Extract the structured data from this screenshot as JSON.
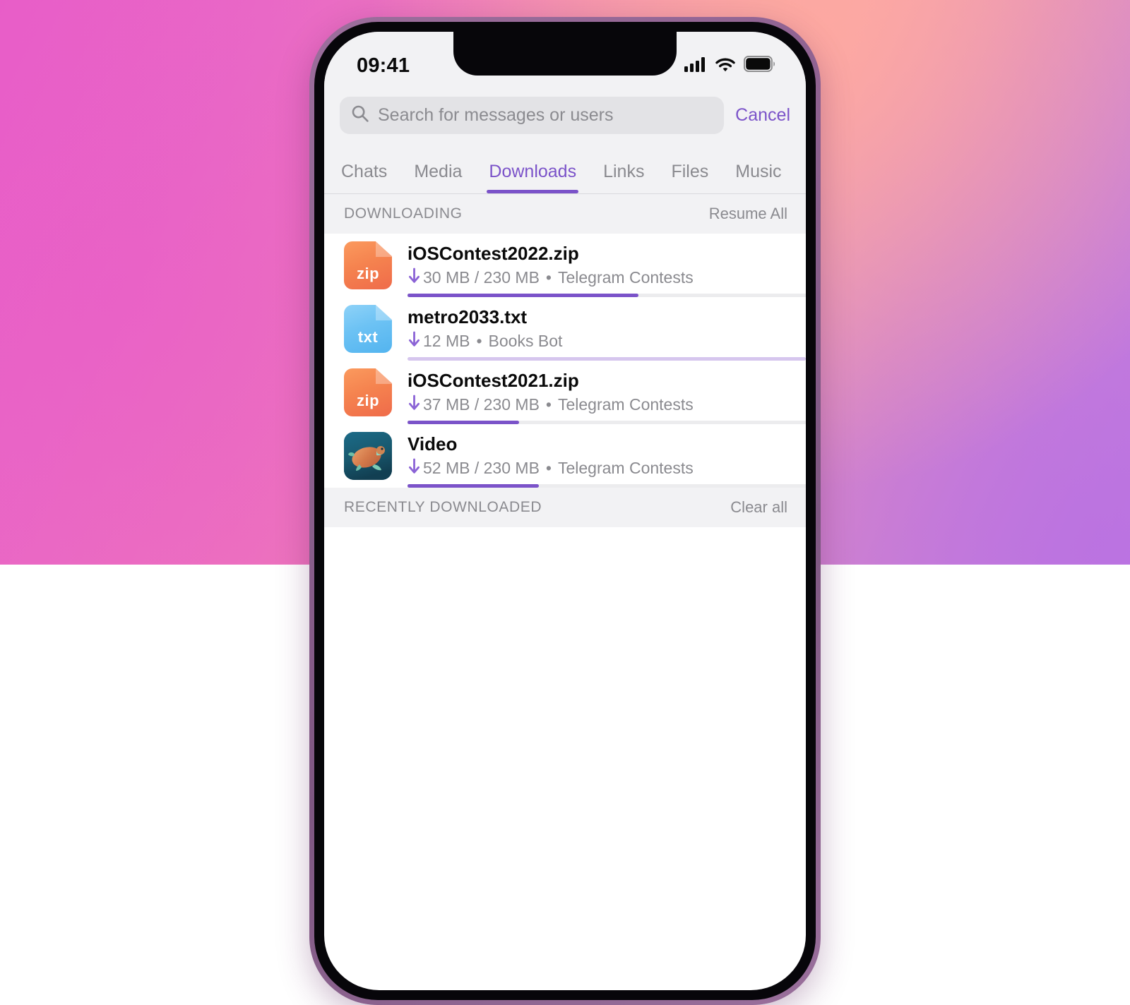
{
  "status_bar": {
    "time": "09:41",
    "signal_icon": "cellular-signal-icon",
    "wifi_icon": "wifi-icon",
    "battery_icon": "battery-full-icon"
  },
  "search": {
    "icon": "search-icon",
    "placeholder": "Search for messages or users",
    "value": "",
    "cancel_label": "Cancel"
  },
  "tabs": [
    {
      "label": "Chats",
      "active": false
    },
    {
      "label": "Media",
      "active": false
    },
    {
      "label": "Downloads",
      "active": true
    },
    {
      "label": "Links",
      "active": false
    },
    {
      "label": "Files",
      "active": false
    },
    {
      "label": "Music",
      "active": false
    }
  ],
  "sections": [
    {
      "title": "DOWNLOADING",
      "action": "Resume All",
      "items": [
        {
          "name": "iOSContest2022.zip",
          "icon": "zip-file-icon",
          "ext": "zip",
          "downloaded": "30 MB",
          "total": "230 MB",
          "size_text": "30 MB / 230 MB",
          "source": "Telegram Contests",
          "progress_percent": 58,
          "progress_style": "solid"
        },
        {
          "name": "metro2033.txt",
          "icon": "txt-file-icon",
          "ext": "txt",
          "downloaded": "12 MB",
          "total": "",
          "size_text": "12 MB",
          "source": "Books Bot",
          "progress_percent": 100,
          "progress_style": "faint"
        },
        {
          "name": "iOSContest2021.zip",
          "icon": "zip-file-icon",
          "ext": "zip",
          "downloaded": "37 MB",
          "total": "230 MB",
          "size_text": "37 MB / 230 MB",
          "source": "Telegram Contests",
          "progress_percent": 28,
          "progress_style": "solid"
        },
        {
          "name": "Video",
          "icon": "video-thumbnail-turtle",
          "ext": "",
          "downloaded": "52 MB",
          "total": "230 MB",
          "size_text": "52 MB / 230 MB",
          "source": "Telegram Contests",
          "progress_percent": 33,
          "progress_style": "solid"
        }
      ]
    },
    {
      "title": "RECENTLY DOWNLOADED",
      "action": "Clear all",
      "items": []
    }
  ],
  "colors": {
    "accent": "#7b53c9",
    "muted_text": "#8a8a8f",
    "header_bg": "#f2f2f4",
    "zip_icon": "#f5834f",
    "txt_icon": "#6cc2f4",
    "progress_faint": "#d6c6ee"
  },
  "download_arrow_glyph": "↓",
  "separator_dot": "•"
}
